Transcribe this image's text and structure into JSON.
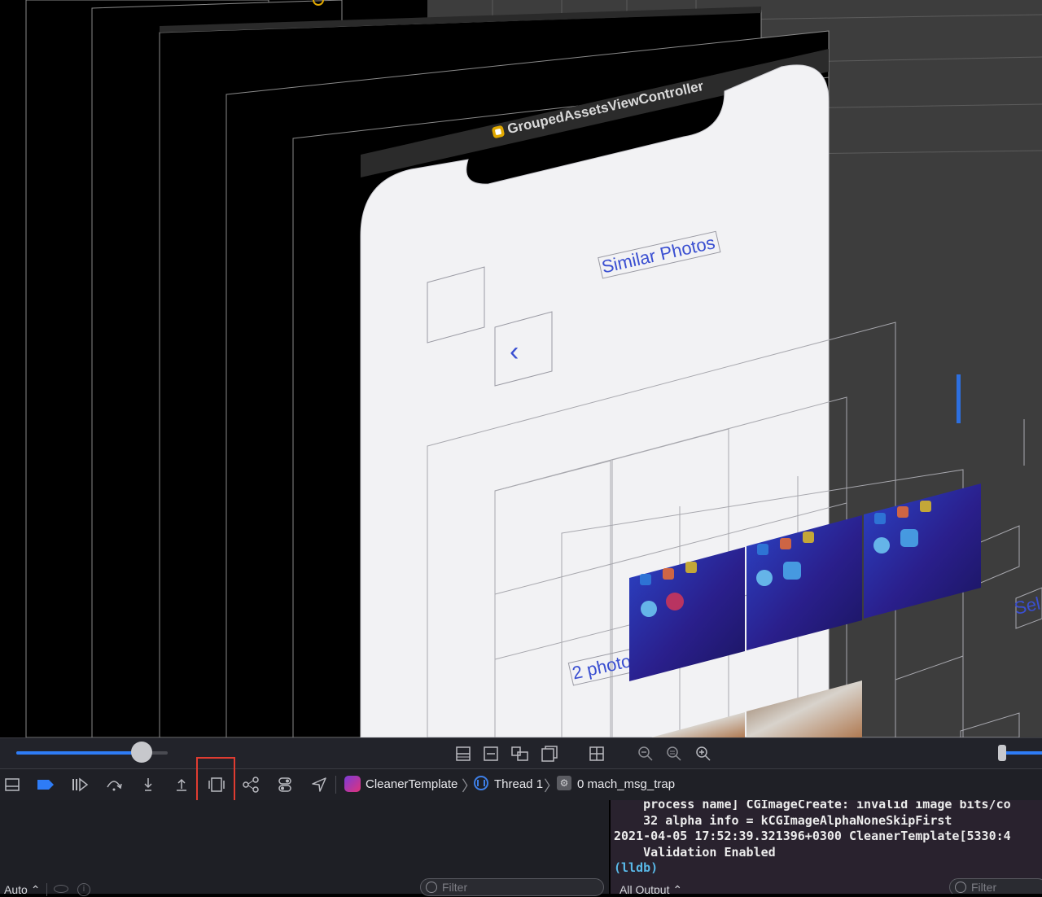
{
  "canvas": {
    "controller_title": "GroupedAssetsViewController",
    "screen_title": "Similar Photos",
    "back_glyph": "‹",
    "photo_count_label": "2 photo",
    "select_label": "Sel",
    "accent": "#3a4fd1"
  },
  "zoom_bar": {
    "left_slider_value": 0.83,
    "icons": [
      "stack-layout-icon",
      "fit-width-icon",
      "show-clipped-icon",
      "show-constraints-icon",
      "grid-icon",
      "zoom-out-icon",
      "zoom-reset-icon",
      "zoom-in-icon"
    ]
  },
  "debug_bar": {
    "icons": [
      "hide-debug-area-icon",
      "breakpoints-icon",
      "continue-icon",
      "step-over-icon",
      "step-into-icon",
      "step-out-icon",
      "view-debugger-icon",
      "memory-graph-icon",
      "environment-overrides-icon",
      "simulate-location-icon"
    ],
    "breadcrumb": {
      "app": "CleanerTemplate",
      "thread": "Thread 1",
      "frame": "0 mach_msg_trap"
    }
  },
  "variables": {
    "scope": "Auto ⌃",
    "filter_placeholder": "Filter"
  },
  "console": {
    "lines": [
      "    process name] CGImageCreate: invalid image bits/co",
      "    32 alpha info = kCGImageAlphaNoneSkipFirst",
      "2021-04-05 17:52:39.321396+0300 CleanerTemplate[5330:4",
      "    Validation Enabled"
    ],
    "prompt": "(lldb)",
    "output_selector": "All Output ⌃",
    "filter_placeholder": "Filter"
  }
}
